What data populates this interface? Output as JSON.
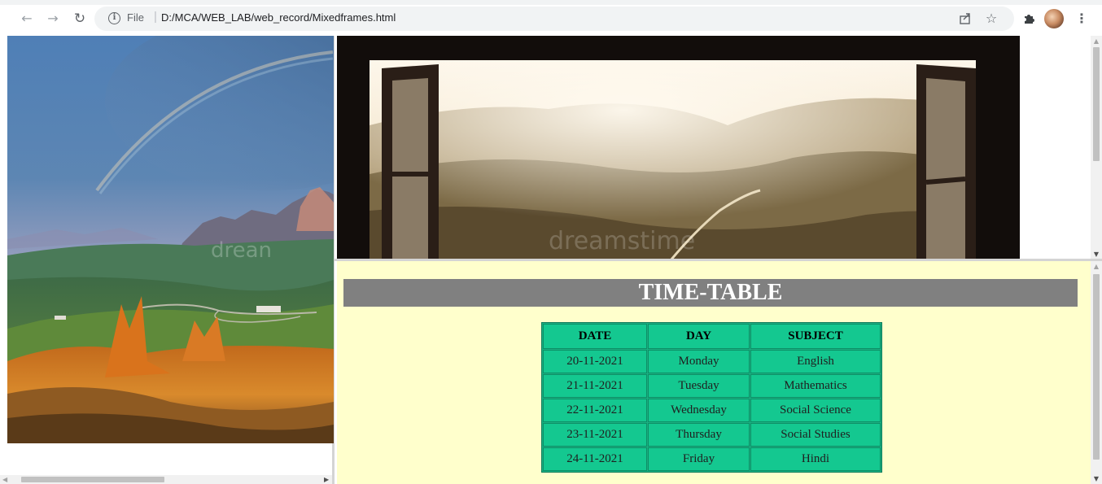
{
  "browser": {
    "url_scheme": "File",
    "url_separator": "|",
    "url_path": "D:/MCA/WEB_LAB/web_record/Mixedframes.html",
    "icons": {
      "back": "arrow-left-icon",
      "forward": "arrow-right-icon",
      "reload": "reload-icon",
      "info": "info-icon",
      "share": "share-icon",
      "bookmark": "star-icon",
      "extensions": "puzzle-icon",
      "menu": "kebab-menu-icon"
    }
  },
  "left_frame": {
    "image_subject": "mountain-landscape-with-rainbow"
  },
  "top_frame": {
    "image_subject": "open-window-sunlit-hills"
  },
  "timetable": {
    "heading": "TIME-TABLE",
    "columns": [
      "DATE",
      "DAY",
      "SUBJECT"
    ],
    "rows": [
      [
        "20-11-2021",
        "Monday",
        "English"
      ],
      [
        "21-11-2021",
        "Tuesday",
        "Mathematics"
      ],
      [
        "22-11-2021",
        "Wednesday",
        "Social Science"
      ],
      [
        "23-11-2021",
        "Thursday",
        "Social Studies"
      ],
      [
        "24-11-2021",
        "Friday",
        "Hindi"
      ]
    ]
  },
  "colors": {
    "timetable_background": "#ffffcc",
    "heading_background": "#808080",
    "table_cell": "#14c890"
  }
}
